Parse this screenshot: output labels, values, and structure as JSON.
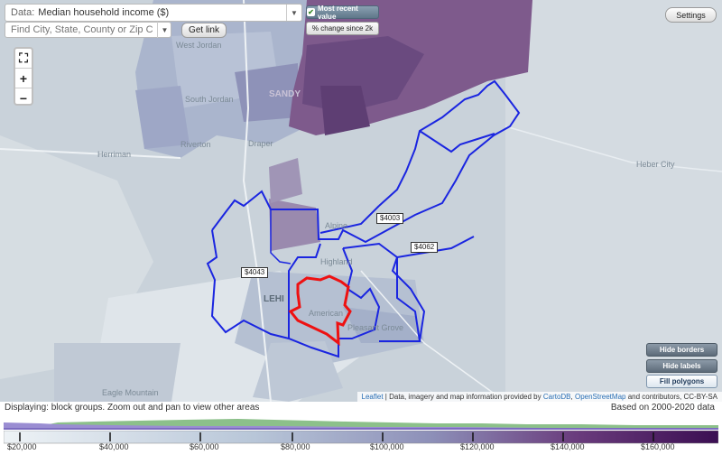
{
  "controls": {
    "data_label": "Data:",
    "data_value": "Median household income ($)",
    "search_placeholder": "Find City, State, County or Zip Code",
    "get_link": "Get link",
    "most_recent": "Most recent value",
    "pct_change": "% change since 2k",
    "settings": "Settings",
    "zoom_fit": "⛶",
    "zoom_in": "+",
    "zoom_out": "−",
    "hide_borders": "Hide borders",
    "hide_labels": "Hide labels",
    "fill_polygons": "Fill polygons"
  },
  "attribution": {
    "leaflet": "Leaflet",
    "rest": " | Data, imagery and map information provided by ",
    "cartodb": "CartoDB",
    "sep": ", ",
    "osm": "OpenStreetMap",
    "tail": " and contributors, CC-BY-SA"
  },
  "map_labels": {
    "west_jordan": "West Jordan",
    "south_jordan": "South Jordan",
    "sandy": "SANDY",
    "riverton": "Riverton",
    "herriman": "Herriman",
    "draper": "Draper",
    "heber_city": "Heber City",
    "alpine": "Alpine",
    "highland": "Highland",
    "lehi": "LEHI",
    "american_fork": "American",
    "pleasant_grove": "Pleasant Grove",
    "eagle_mountain": "Eagle Mountain",
    "box1": "$4003",
    "box2": "$4062",
    "box3": "$4043"
  },
  "footer": {
    "displaying": "Displaying: block groups. Zoom out and pan to view other areas",
    "based_on": "Based on 2000-2020 data"
  },
  "legend": {
    "ticks": [
      "$20,000",
      "$40,000",
      "$60,000",
      "$80,000",
      "$100,000",
      "$120,000",
      "$140,000",
      "$160,000"
    ],
    "colors": {
      "low": "#e7eff4",
      "mid": "#9fb0cc",
      "high": "#3b0e52"
    }
  }
}
